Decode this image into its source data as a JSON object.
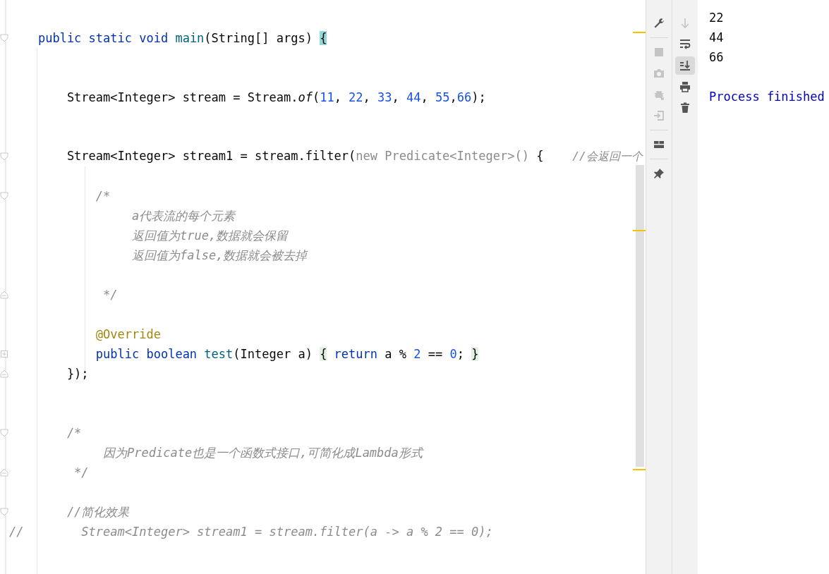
{
  "editor": {
    "lines": [
      {
        "kind": "fold-start",
        "tokens": [
          {
            "kind": "kw",
            "text": "    public static void "
          },
          {
            "kind": "fn",
            "text": "main"
          },
          {
            "kind": "plain",
            "text": "(String[] args) "
          },
          {
            "kind": "brace-match",
            "text": "{"
          }
        ]
      },
      {
        "kind": "blank"
      },
      {
        "kind": "blank"
      },
      {
        "kind": "code",
        "tokens": [
          {
            "kind": "plain",
            "text": "        Stream<Integer> stream = Stream."
          },
          {
            "kind": "static",
            "text": "of"
          },
          {
            "kind": "plain",
            "text": "("
          },
          {
            "kind": "num",
            "text": "11"
          },
          {
            "kind": "plain",
            "text": ", "
          },
          {
            "kind": "num",
            "text": "22"
          },
          {
            "kind": "plain",
            "text": ", "
          },
          {
            "kind": "num",
            "text": "33"
          },
          {
            "kind": "plain",
            "text": ", "
          },
          {
            "kind": "num",
            "text": "44"
          },
          {
            "kind": "plain",
            "text": ", "
          },
          {
            "kind": "num",
            "text": "55"
          },
          {
            "kind": "plain",
            "text": ","
          },
          {
            "kind": "num",
            "text": "66"
          },
          {
            "kind": "plain",
            "text": ");"
          }
        ]
      },
      {
        "kind": "blank"
      },
      {
        "kind": "blank"
      },
      {
        "kind": "fold-start",
        "tokens": [
          {
            "kind": "plain",
            "text": "        Stream<Integer> stream1 = stream.filter("
          },
          {
            "kind": "ghost",
            "text": "new Predicate<Integer>()"
          },
          {
            "kind": "plain",
            "text": " {    "
          },
          {
            "kind": "comment-tail",
            "text": "//会返回一个"
          }
        ]
      },
      {
        "kind": "blank"
      },
      {
        "kind": "fold-start",
        "tokens": [
          {
            "kind": "comment",
            "text": "            /*"
          }
        ]
      },
      {
        "kind": "code",
        "tokens": [
          {
            "kind": "comment",
            "text": "                 a代表流的每个元素"
          }
        ]
      },
      {
        "kind": "code",
        "tokens": [
          {
            "kind": "comment",
            "text": "                 返回值为true,数据就会保留"
          }
        ]
      },
      {
        "kind": "code",
        "tokens": [
          {
            "kind": "comment",
            "text": "                 返回值为false,数据就会被去掉"
          }
        ]
      },
      {
        "kind": "blank"
      },
      {
        "kind": "fold-end",
        "tokens": [
          {
            "kind": "comment",
            "text": "             */"
          }
        ]
      },
      {
        "kind": "blank"
      },
      {
        "kind": "code",
        "tokens": [
          {
            "kind": "annotation",
            "text": "            @Override"
          }
        ]
      },
      {
        "kind": "folded",
        "tokens": [
          {
            "kind": "kw",
            "text": "            public boolean "
          },
          {
            "kind": "fn",
            "text": "test"
          },
          {
            "kind": "plain",
            "text": "(Integer a) "
          },
          {
            "kind": "fold-brace",
            "text": "{"
          },
          {
            "kind": "kw",
            "text": " return"
          },
          {
            "kind": "plain",
            "text": " a % "
          },
          {
            "kind": "num",
            "text": "2"
          },
          {
            "kind": "plain",
            "text": " == "
          },
          {
            "kind": "num",
            "text": "0"
          },
          {
            "kind": "plain",
            "text": "; "
          },
          {
            "kind": "fold-brace",
            "text": "}"
          }
        ]
      },
      {
        "kind": "fold-end",
        "tokens": [
          {
            "kind": "plain",
            "text": "        });"
          }
        ]
      },
      {
        "kind": "blank"
      },
      {
        "kind": "blank"
      },
      {
        "kind": "fold-start",
        "tokens": [
          {
            "kind": "comment",
            "text": "        /*"
          }
        ]
      },
      {
        "kind": "code",
        "tokens": [
          {
            "kind": "comment",
            "text": "             因为Predicate也是一个函数式接口,可简化成Lambda形式"
          }
        ]
      },
      {
        "kind": "fold-end",
        "tokens": [
          {
            "kind": "comment",
            "text": "         */"
          }
        ]
      },
      {
        "kind": "blank"
      },
      {
        "kind": "fold-start",
        "tokens": [
          {
            "kind": "comment",
            "text": "        //简化效果"
          }
        ]
      },
      {
        "kind": "code",
        "tokens": [
          {
            "kind": "comment",
            "text": "//        Stream<Integer> stream1 = stream.filter(a -> a % 2 == 0);"
          }
        ]
      }
    ]
  },
  "toolbar_left": [
    {
      "kind": "wrench",
      "disabled": false
    },
    {
      "kind": "separator"
    },
    {
      "kind": "stop",
      "disabled": true
    },
    {
      "kind": "camera",
      "disabled": true
    },
    {
      "kind": "bug",
      "disabled": true
    },
    {
      "kind": "login",
      "disabled": true
    },
    {
      "kind": "separator"
    },
    {
      "kind": "layout",
      "disabled": false
    },
    {
      "kind": "separator"
    },
    {
      "kind": "pin",
      "disabled": false
    }
  ],
  "toolbar_right": [
    {
      "kind": "down",
      "disabled": true,
      "selected": false
    },
    {
      "kind": "wrap",
      "disabled": false,
      "selected": false
    },
    {
      "kind": "scroll-end",
      "disabled": false,
      "selected": true
    },
    {
      "kind": "print",
      "disabled": false,
      "selected": false
    },
    {
      "kind": "trash",
      "disabled": false,
      "selected": false
    }
  ],
  "console": {
    "lines": [
      {
        "kind": "output",
        "text": "22"
      },
      {
        "kind": "output",
        "text": "44"
      },
      {
        "kind": "output",
        "text": "66"
      },
      {
        "kind": "blank"
      },
      {
        "kind": "system",
        "text": "Process finished"
      }
    ]
  }
}
